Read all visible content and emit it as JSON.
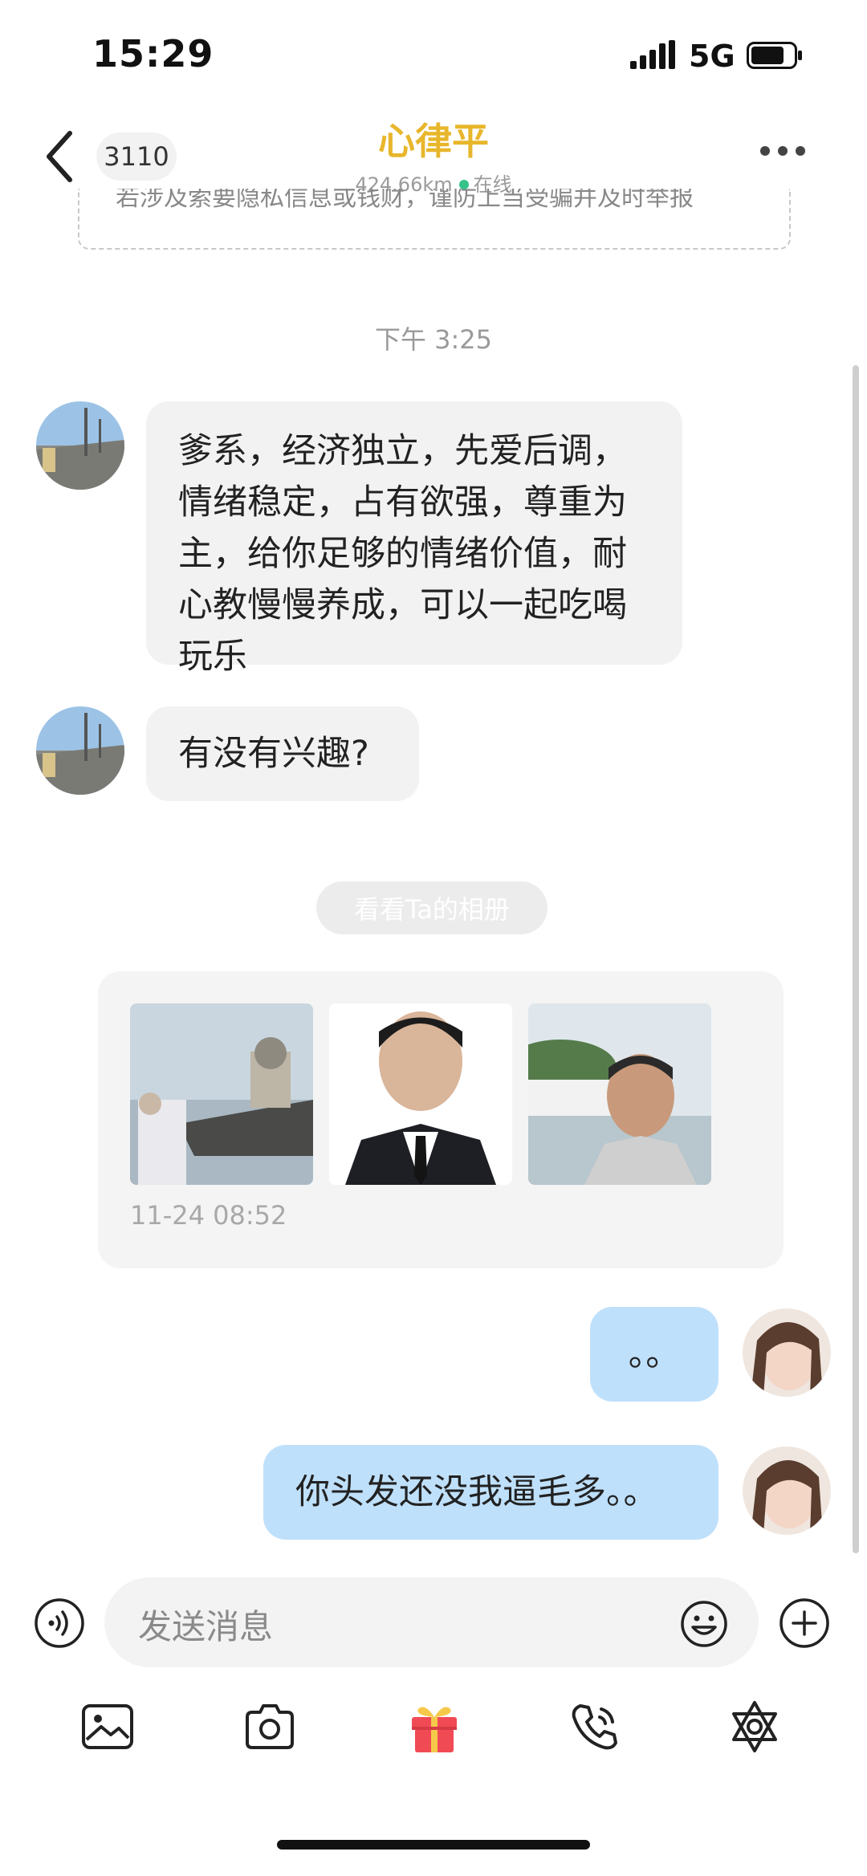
{
  "status_bar": {
    "time": "15:29",
    "network": "5G"
  },
  "header": {
    "badge": "3110",
    "title": "心律平",
    "distance": "424.66km",
    "online": "在线",
    "notice": "若涉及索要隐私信息或钱财，谨防上当受骗并及时举报"
  },
  "chat": {
    "timestamp": "下午 3:25",
    "incoming": [
      {
        "lines": [
          "爹系，经济独立，先爱后调，",
          "情绪稳定，占有欲强，尊重为",
          "主，给你足够的情绪价值，耐",
          "心教慢慢养成，可以一起吃喝",
          "玩乐"
        ]
      },
      {
        "lines": [
          "有没有兴趣?"
        ]
      }
    ],
    "album_button": "看看Ta的相册",
    "album_date": "11-24 08:52",
    "outgoing": [
      {
        "text": "。。"
      },
      {
        "text": "你头发还没我逼毛多。。"
      }
    ]
  },
  "composer": {
    "placeholder": "发送消息"
  },
  "toolbar": {
    "icons": [
      "image-icon",
      "camera-icon",
      "gift-icon",
      "phone-call-icon",
      "settings-star-icon"
    ]
  },
  "colors": {
    "title": "#e8b62c",
    "outgoing_bubble": "#bfe0fb",
    "incoming_bubble": "#f2f2f2",
    "online_dot": "#34c28a"
  }
}
